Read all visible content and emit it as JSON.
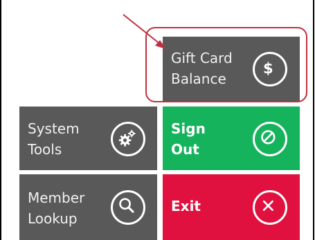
{
  "tiles": {
    "gift_card_balance": {
      "label": "Gift Card\nBalance",
      "icon": "dollar-circle-icon"
    },
    "system_tools": {
      "label": "System\nTools",
      "icon": "gears-icon"
    },
    "sign_out": {
      "label": "Sign\nOut",
      "icon": "prohibited-icon"
    },
    "member_lookup": {
      "label": "Member\nLookup",
      "icon": "magnifier-icon"
    },
    "exit": {
      "label": "Exit",
      "icon": "close-circle-icon"
    }
  },
  "colors": {
    "tile_gray": "#595959",
    "sign_out_green": "#16b35d",
    "exit_red": "#e0103f",
    "annotation_red": "#c02f3e"
  }
}
